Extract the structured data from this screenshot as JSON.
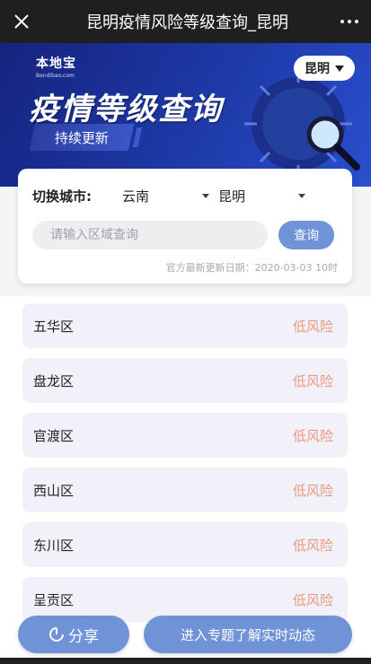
{
  "topbar": {
    "title": "昆明疫情风险等级查询_昆明",
    "close_icon": "close-icon",
    "more_icon": "more-icon"
  },
  "banner": {
    "logo_main": "本地宝",
    "logo_sub": "Bendibao.com",
    "title": "疫情等级查询",
    "subtitle": "持续更新",
    "city": "昆明"
  },
  "search_card": {
    "switch_label": "切换城市:",
    "province": "云南",
    "city": "昆明",
    "placeholder": "请输入区域查询",
    "query_button": "查询",
    "update_text": "官方最新更新日期：2020-03-03 10时"
  },
  "districts": [
    {
      "name": "五华区",
      "risk": "低风险"
    },
    {
      "name": "盘龙区",
      "risk": "低风险"
    },
    {
      "name": "官渡区",
      "risk": "低风险"
    },
    {
      "name": "西山区",
      "risk": "低风险"
    },
    {
      "name": "东川区",
      "risk": "低风险"
    },
    {
      "name": "呈贡区",
      "risk": "低风险"
    }
  ],
  "bottom": {
    "share": "分享",
    "topic": "进入专题了解实时动态"
  },
  "colors": {
    "accent": "#6f93d6",
    "risk_low": "#e79a7f",
    "banner": "#1e3aa8"
  }
}
